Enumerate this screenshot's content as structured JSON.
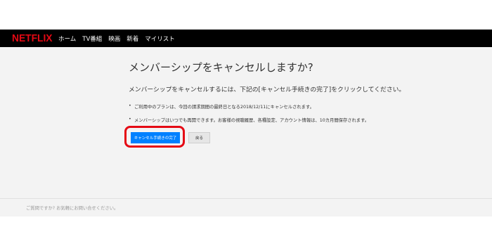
{
  "brand": {
    "logo": "NETFLIX",
    "accent": "#e50914"
  },
  "nav": {
    "items": [
      {
        "label": "ホーム"
      },
      {
        "label": "TV番組"
      },
      {
        "label": "映画"
      },
      {
        "label": "新着"
      },
      {
        "label": "マイリスト"
      }
    ]
  },
  "main": {
    "title": "メンバーシップをキャンセルしますか?",
    "subtitle": "メンバーシップをキャンセルするには、下記の[キャンセル手続きの完了]をクリックしてください。",
    "bullets": [
      "ご利用中のプランは、今回の請求期間の最終日となる2018/12/11にキャンセルされます。",
      "メンバーシップはいつでも再開できます。お客様の視聴履歴、各種設定、アカウント情報は、10カ月間保存されます。"
    ],
    "confirm_button": "キャンセル手続きの完了",
    "back_button": "戻る",
    "primary_color": "#0080ff"
  },
  "footer": {
    "text": "ご質問ですか? お気軽にお問い合せください。"
  }
}
